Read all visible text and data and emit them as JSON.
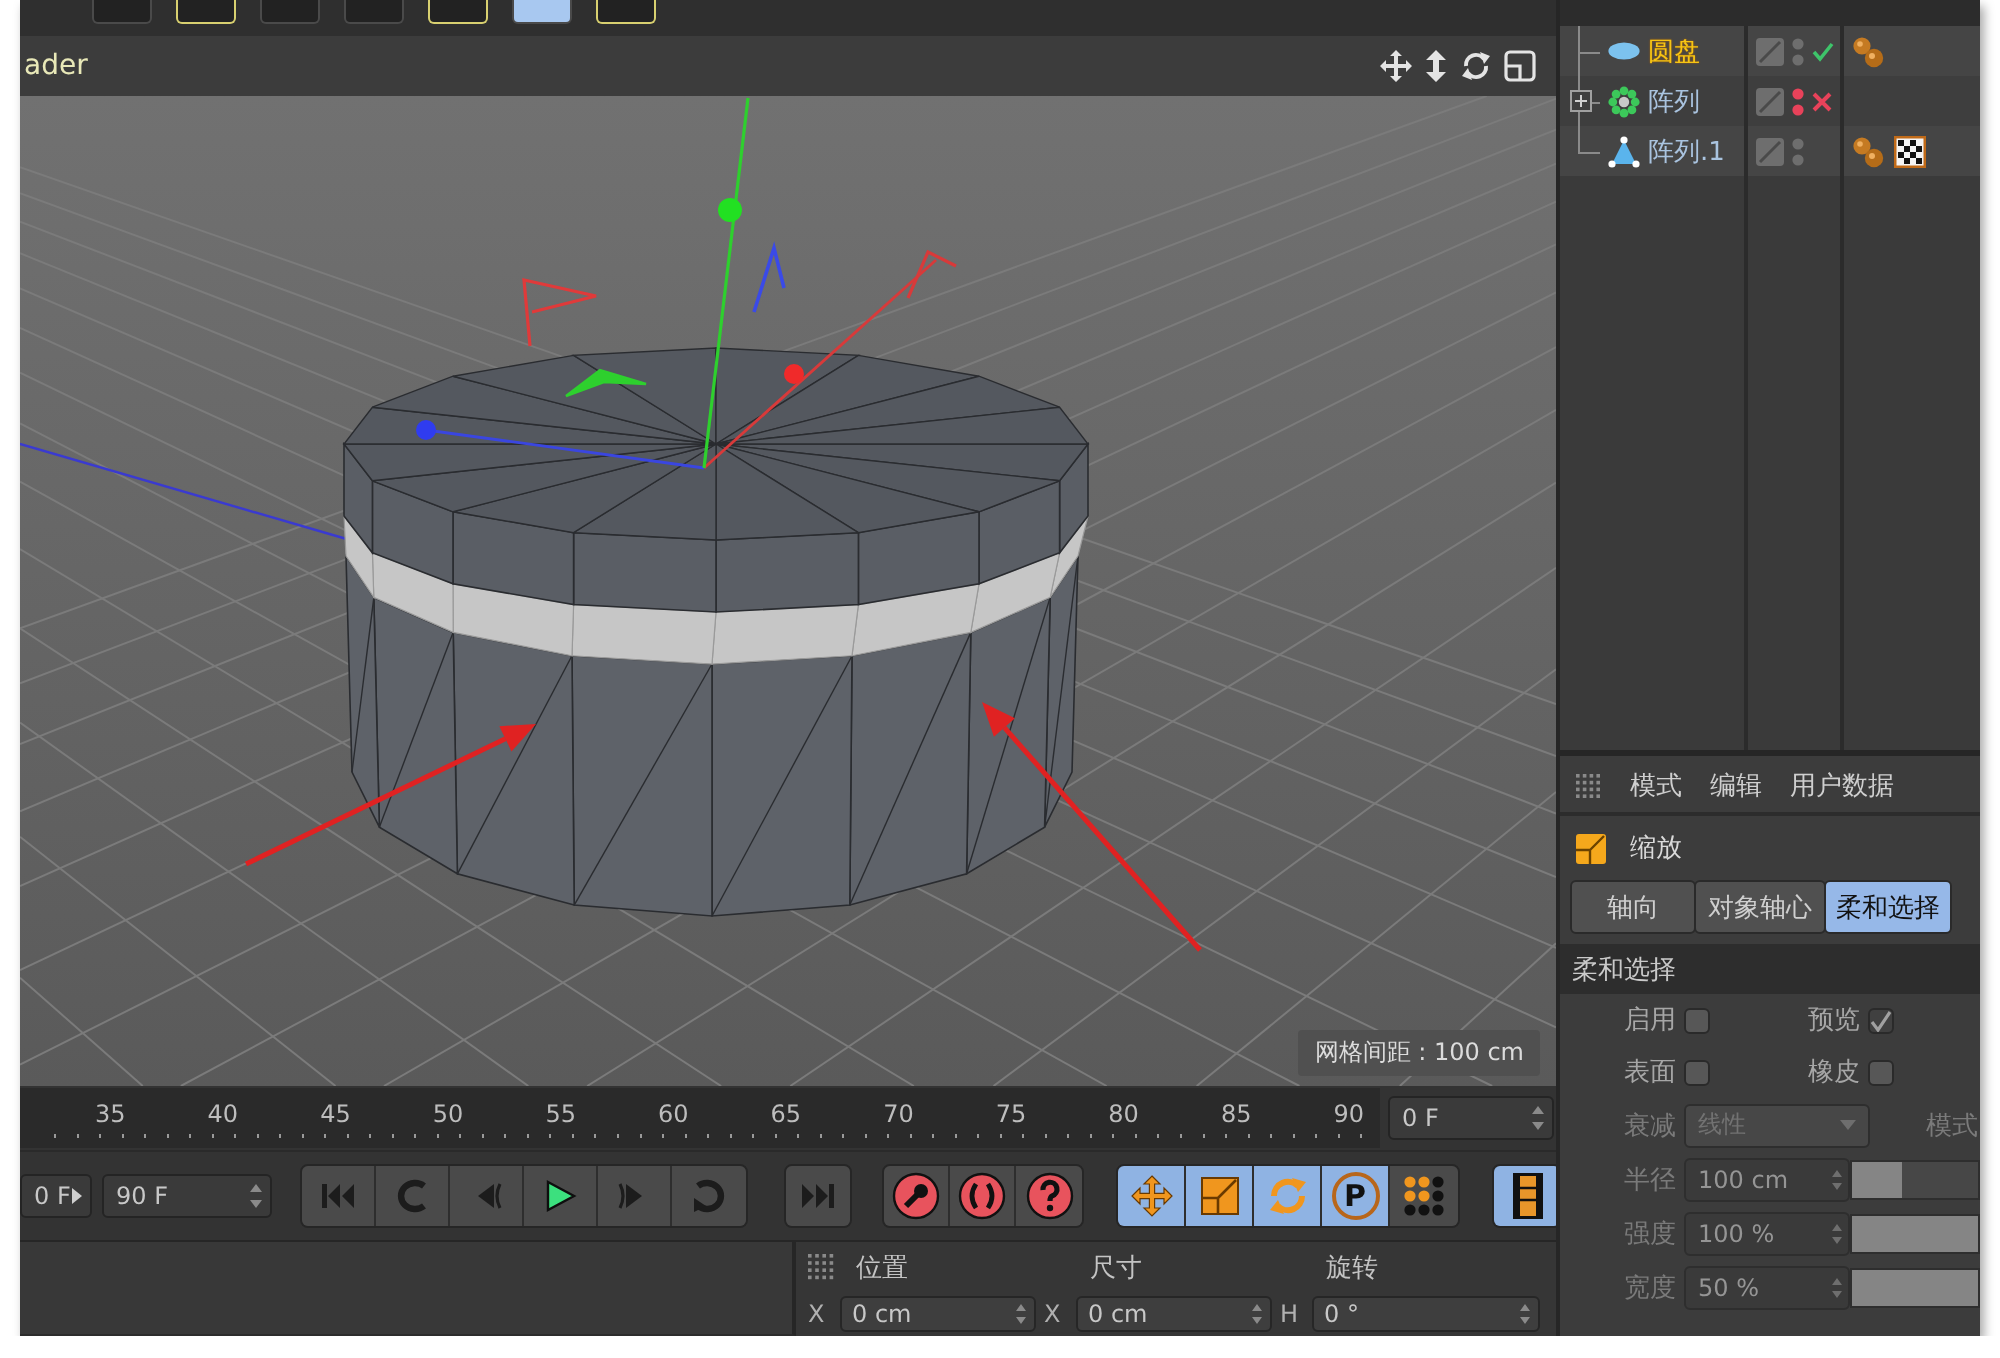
{
  "top_toolbar": [
    {
      "kind": "plain",
      "selected": false
    },
    {
      "kind": "framed",
      "selected": false
    },
    {
      "kind": "plain",
      "selected": false
    },
    {
      "kind": "plain",
      "selected": false
    },
    {
      "kind": "framed",
      "selected": false
    },
    {
      "kind": "plain",
      "selected": true
    },
    {
      "kind": "framed",
      "selected": false
    }
  ],
  "viewport": {
    "menu_text": "ader",
    "grid_spacing": "网格间距 : 100 cm"
  },
  "object_manager": {
    "objects": [
      {
        "name": "圆盘",
        "kind": "disc",
        "selected": true,
        "visible": true,
        "enabled": true,
        "tags": [
          {
            "kind": "phong"
          }
        ]
      },
      {
        "name": "阵列",
        "kind": "array",
        "selected": false,
        "expanded": false,
        "visible": false,
        "enabled": false
      },
      {
        "name": "阵列.1",
        "kind": "cone",
        "selected": false,
        "visible": true,
        "tags": [
          {
            "kind": "phong"
          },
          {
            "kind": "texture"
          }
        ]
      }
    ]
  },
  "attribute_manager": {
    "menu": [
      "模式",
      "编辑",
      "用户数据"
    ],
    "title": "缩放",
    "tabs": [
      {
        "label": "轴向",
        "selected": false
      },
      {
        "label": "对象轴心",
        "selected": false
      },
      {
        "label": "柔和选择",
        "selected": true
      }
    ],
    "section": "柔和选择",
    "checkboxes": [
      {
        "label": "启用",
        "checked": false
      },
      {
        "label": "预览",
        "checked": true
      },
      {
        "label": "表面",
        "checked": false
      },
      {
        "label": "橡皮",
        "checked": false
      }
    ],
    "falloff": {
      "label": "衰减",
      "value": "线性",
      "disabled": true
    },
    "mode_label": "模式",
    "params": [
      {
        "label": "半径",
        "value": "100 cm",
        "level": 0.4,
        "disabled": true
      },
      {
        "label": "强度",
        "value": "100 %",
        "level": 1,
        "disabled": true
      },
      {
        "label": "宽度",
        "value": "50 %",
        "level": 1,
        "disabled": true
      }
    ]
  },
  "timeline": {
    "ruler": [
      "35",
      "40",
      "45",
      "50",
      "55",
      "60",
      "65",
      "70",
      "75",
      "80",
      "85",
      "90"
    ],
    "current_frame": "0 F"
  },
  "transport": {
    "start_frame": "0 F",
    "end_frame": "90 F",
    "key_tools": [
      {
        "kind": "move",
        "selected": true
      },
      {
        "kind": "scale",
        "selected": true
      },
      {
        "kind": "rotate",
        "selected": true
      },
      {
        "kind": "parameter",
        "label": "P",
        "selected": true
      },
      {
        "kind": "point_level",
        "selected": false
      }
    ],
    "filmstrip": {
      "selected": true
    }
  },
  "coordinates": {
    "headers": [
      "位置",
      "尺寸",
      "旋转"
    ],
    "fields": [
      {
        "axis": "X",
        "value": "0 cm"
      },
      {
        "axis": "X",
        "value": "0 cm"
      },
      {
        "axis": "H",
        "value": "0 °"
      }
    ]
  }
}
